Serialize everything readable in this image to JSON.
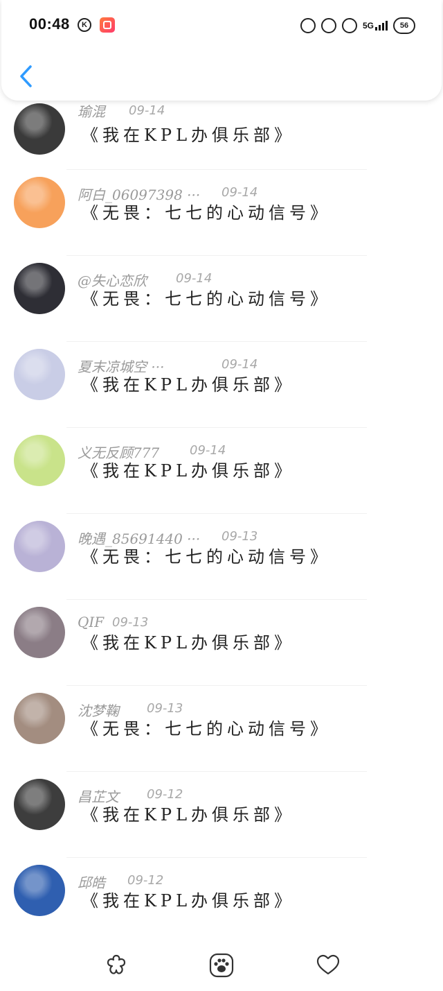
{
  "status": {
    "time": "00:48",
    "k_label": "K",
    "network": "5G",
    "battery": "56"
  },
  "items": [
    {
      "name": "瑜混",
      "date": "09-14",
      "title": "《我在KPL办俱乐部》",
      "avatar_color": "#3a3a3a"
    },
    {
      "name": "阿白_06097398 ···",
      "date": "09-14",
      "title": "《无畏：七七的心动信号》",
      "avatar_color": "#f7a15b"
    },
    {
      "name": "@失心恋欣",
      "date": "09-14",
      "title": "《无畏：七七的心动信号》",
      "avatar_color": "#2e2e35"
    },
    {
      "name": "夏末凉城空 ···",
      "date": "09-14",
      "title": "《我在KPL办俱乐部》",
      "avatar_color": "#c9cde6"
    },
    {
      "name": "义无反顾777",
      "date": "09-14",
      "title": "《我在KPL办俱乐部》",
      "avatar_color": "#c9e38a"
    },
    {
      "name": "晚遇_85691440 ···",
      "date": "09-13",
      "title": "《无畏：七七的心动信号》",
      "avatar_color": "#b9b2d6"
    },
    {
      "name": "QIF",
      "date": "09-13",
      "title": "《我在KPL办俱乐部》",
      "avatar_color": "#8b7d86"
    },
    {
      "name": "沈梦鞠",
      "date": "09-13",
      "title": "《无畏：七七的心动信号》",
      "avatar_color": "#a38d80"
    },
    {
      "name": "昌芷文",
      "date": "09-12",
      "title": "《我在KPL办俱乐部》",
      "avatar_color": "#3d3d3d"
    },
    {
      "name": "邱皓",
      "date": "09-12",
      "title": "《我在KPL办俱乐部》",
      "avatar_color": "#2f5fb0"
    }
  ],
  "tabs": [
    {
      "name": "flower-icon"
    },
    {
      "name": "paw-icon"
    },
    {
      "name": "heart-icon"
    }
  ],
  "colors": {
    "accent": "#2f9bff",
    "text": "#222222",
    "muted": "#9a9a9a"
  }
}
